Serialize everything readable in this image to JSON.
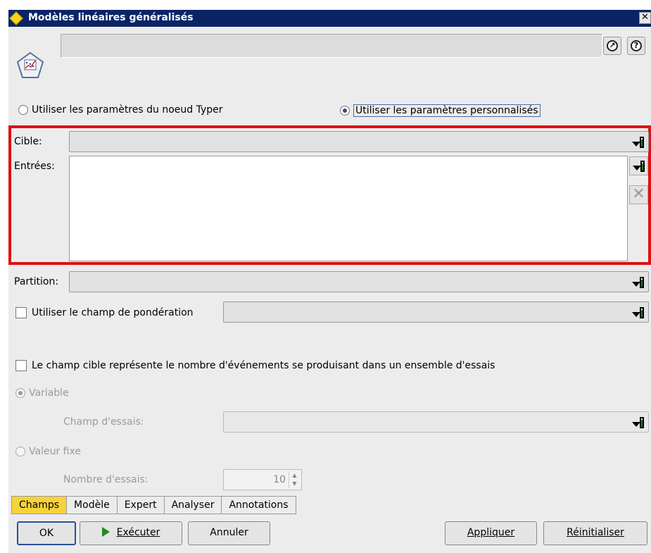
{
  "window": {
    "title": "Modèles linéaires généralisés",
    "close_glyph": "✕"
  },
  "header": {
    "node_name_value": "",
    "node_icon": "glm-node-icon",
    "info_icon": "arrow-up-right-icon",
    "help_icon": "help-icon"
  },
  "mode": {
    "typer_label": "Utiliser les paramètres du noeud Typer",
    "custom_label": "Utiliser les paramètres personnalisés",
    "selected": "custom"
  },
  "fields": {
    "target_label": "Cible:",
    "target_value": "",
    "inputs_label": "Entrées:",
    "partition_label": "Partition:",
    "partition_value": "",
    "weight_label": "Utiliser le champ de pondération",
    "weight_checked": false
  },
  "trials": {
    "checkbox_label": "Le champ cible représente le nombre d'événements se produisant dans un ensemble d'essais",
    "checked": false,
    "variable_label": "Variable",
    "trials_field_label": "Champ d'essais:",
    "fixed_label": "Valeur fixe",
    "count_label": "Nombre d'essais:",
    "count_value": "10"
  },
  "tabs": [
    {
      "label": "Champs",
      "active": true
    },
    {
      "label": "Modèle",
      "active": false
    },
    {
      "label": "Expert",
      "active": false
    },
    {
      "label": "Analyser",
      "active": false
    },
    {
      "label": "Annotations",
      "active": false
    }
  ],
  "buttons": {
    "ok": "OK",
    "run": "Exécuter",
    "cancel": "Annuler",
    "apply": "Appliquer",
    "reset": "Réinitialiser"
  },
  "colors": {
    "titlebar": "#0a2466",
    "active_tab": "#f7d23a",
    "highlight_box": "#e01010"
  }
}
